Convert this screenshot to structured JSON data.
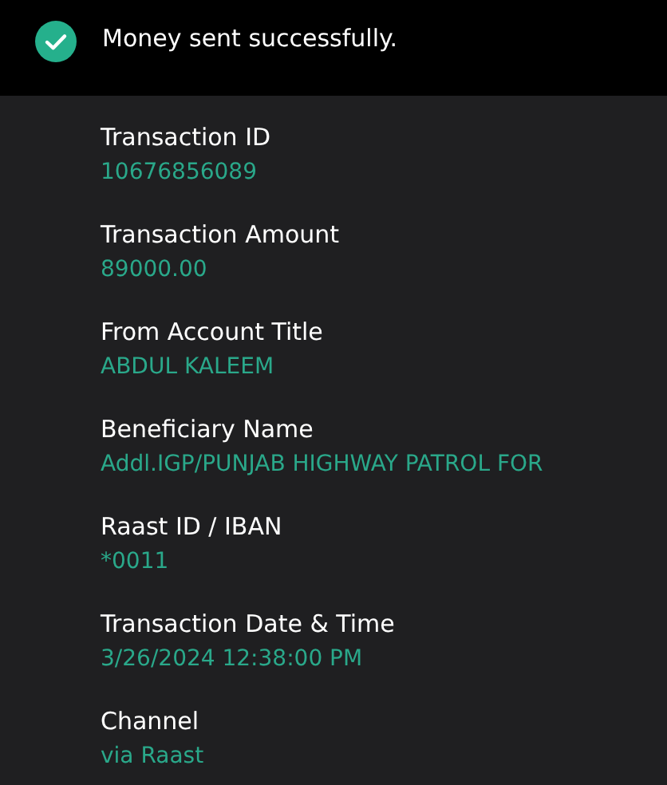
{
  "banner": {
    "message": "Money sent successfully."
  },
  "fields": [
    {
      "label": "Transaction ID",
      "value": "10676856089"
    },
    {
      "label": "Transaction Amount",
      "value": "89000.00"
    },
    {
      "label": "From Account Title",
      "value": "ABDUL KALEEM"
    },
    {
      "label": "Beneficiary Name",
      "value": "Addl.IGP/PUNJAB HIGHWAY PATROL FOR"
    },
    {
      "label": "Raast ID / IBAN",
      "value": "*0011"
    },
    {
      "label": "Transaction Date & Time",
      "value": "3/26/2024 12:38:00 PM"
    },
    {
      "label": "Channel",
      "value": "via Raast"
    }
  ]
}
